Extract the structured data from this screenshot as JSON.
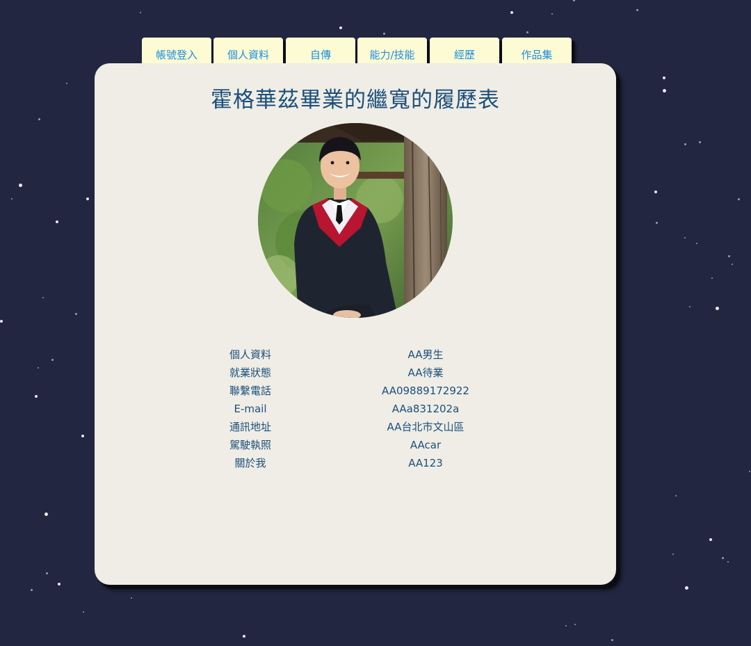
{
  "colors": {
    "background": "#222640",
    "card": "#efede5",
    "tab_background": "#fdfbd4",
    "tab_text": "#1f8de0",
    "heading_text": "#1b4f7c"
  },
  "nav": {
    "tabs": [
      {
        "label": "帳號登入"
      },
      {
        "label": "個人資料"
      },
      {
        "label": "自傳"
      },
      {
        "label": "能力/技能"
      },
      {
        "label": "經歷"
      },
      {
        "label": "作品集"
      }
    ]
  },
  "resume": {
    "title": "霍格華茲畢業的繼寬的履歷表",
    "photo_subject": "graduate-portrait",
    "rows": [
      {
        "label": "個人資料",
        "value": "AA男生"
      },
      {
        "label": "就業狀態",
        "value": "AA待業"
      },
      {
        "label": "聯繫電話",
        "value": "AA09889172922"
      },
      {
        "label": "E-mail",
        "value": "AAa831202a"
      },
      {
        "label": "通訊地址",
        "value": "AA台北市文山區"
      },
      {
        "label": "駕駛執照",
        "value": "AAcar"
      },
      {
        "label": "關於我",
        "value": "AA123"
      }
    ]
  }
}
